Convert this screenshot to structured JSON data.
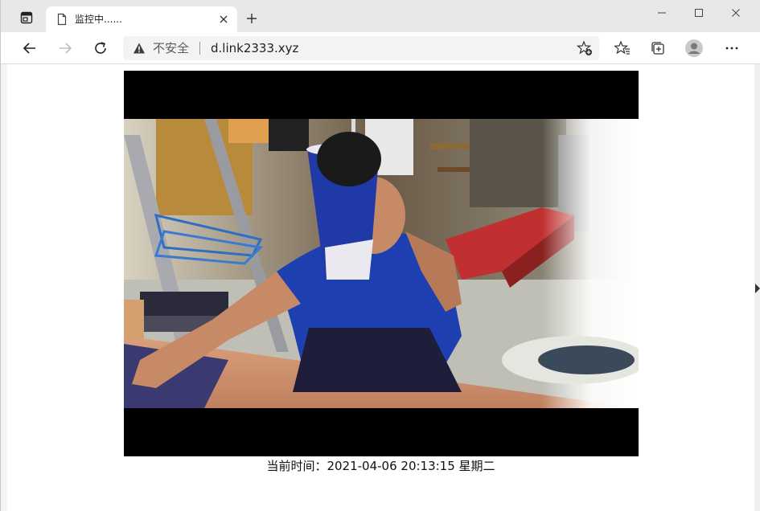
{
  "browser": {
    "tab": {
      "title": "监控中......",
      "favicon": "page-icon",
      "close_icon": "close-icon"
    },
    "new_tab_icon": "plus-icon",
    "window_controls": [
      "minimize-icon",
      "maximize-icon",
      "close-icon"
    ],
    "toolbar": {
      "back_icon": "back-arrow-icon",
      "forward_icon": "forward-arrow-icon",
      "refresh_icon": "refresh-icon",
      "security_label": "不安全",
      "url": "d.link2333.xyz",
      "favorites_add_icon": "star-add-icon",
      "favorites_icon": "favorites-icon",
      "collections_icon": "collections-icon",
      "profile_icon": "avatar-icon",
      "menu_icon": "more-icon"
    }
  },
  "page": {
    "video_stream": {
      "description_icon": "camera-feed"
    },
    "caption": "当前时间：2021-04-06 20:13:15 星期二"
  },
  "colors": {
    "tabbar_bg": "#e8e8e8",
    "toolbar_bg": "#ffffff",
    "address_bg": "#f3f3f3",
    "video_bg": "#000000",
    "shirt_blue": "#1d3fb0",
    "cup_blue": "#1f3aa6"
  }
}
